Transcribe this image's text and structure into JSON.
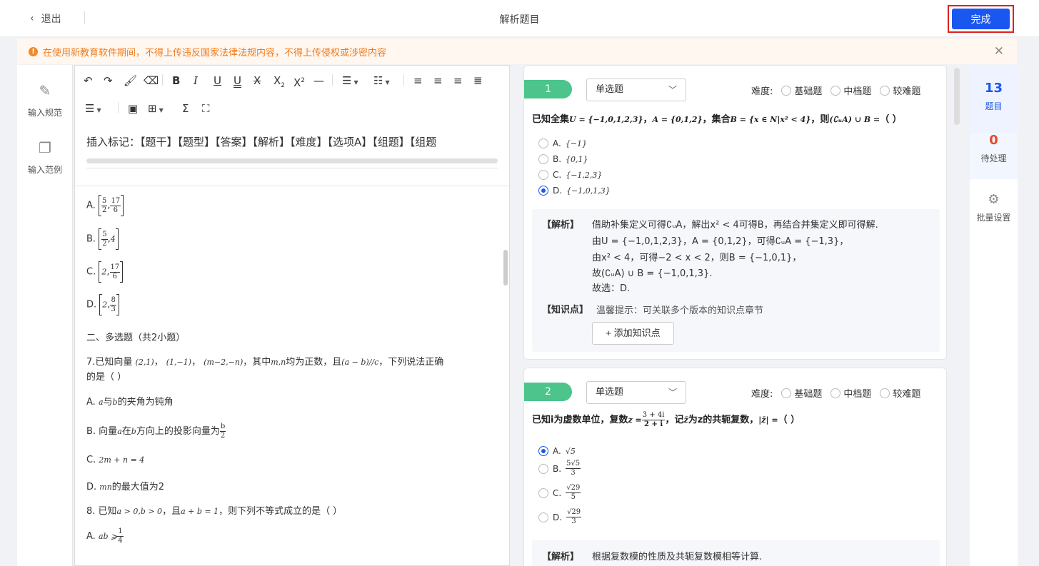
{
  "header": {
    "exit_label": "退出",
    "title": "解析题目",
    "done_label": "完成"
  },
  "notice": {
    "text": "在使用新教育软件期间，不得上传违反国家法律法规内容，不得上传侵权或涉密内容"
  },
  "leftnav": {
    "items": [
      {
        "label": "输入规范"
      },
      {
        "label": "输入范例"
      }
    ]
  },
  "editor": {
    "insert_marks": "插入标记：【题干】【题型】【答案】【解析】【难度】【选项A】【组题】【组题",
    "lines": [
      "A.",
      "B.",
      "C.",
      "D.",
      "二、多选题（共2小题）",
      "7.已知向量",
      "的是（  ）",
      "A. ",
      "B. 向量",
      "C. ",
      "D. ",
      "8. 已知",
      "A. "
    ],
    "frag": {
      "a_fracs": [
        "5",
        "2",
        "17",
        "6"
      ],
      "b": "4",
      "c": "2",
      "d_fracs": [
        "8",
        "3"
      ],
      "q7_a": "(2,1)",
      "q7_b": "(1,−1)",
      "q7_c": "(m−2,−n)",
      "q7_mid": "，其中",
      "q7_mn": "m,n",
      "q7_tail": "均为正数，且",
      "q7_cond": "(a − b)//c",
      "q7_end": "，下列说法正确",
      "q7a_txt": "与",
      "q7a_end": "的夹角为钝角",
      "q7b_mid": "在",
      "q7b_end": "方向上的投影向量为",
      "q7c": "2m + n = 4",
      "q7d_mn": "mn",
      "q7d_txt": "的最大值为2",
      "q8_cond1": "a > 0,b > 0",
      "q8_mid": "，且",
      "q8_cond2": "a + b = 1",
      "q8_end": "，则下列不等式成立的是（    ）",
      "q8a": "ab ⩾",
      "q8a_f": [
        "1",
        "4"
      ]
    }
  },
  "questions": [
    {
      "number": "1",
      "type": "单选题",
      "difficulty_label": "难度:",
      "difficulty_options": [
        "基础题",
        "中档题",
        "较难题"
      ],
      "stem_prefix": "已知全集",
      "stem_u": "U = {−1,0,1,2,3}",
      "stem_a": "A = {0,1,2}",
      "stem_mid": "，集合",
      "stem_b": "B = {x ∈ N|x² < 4}",
      "stem_then": "，则",
      "stem_expr": "(∁ᵤA) ∪ B =",
      "stem_end": "（  ）",
      "options": [
        {
          "label": "A.",
          "value": "{−1}",
          "selected": false
        },
        {
          "label": "B.",
          "value": "{0,1}",
          "selected": false
        },
        {
          "label": "C.",
          "value": "{−1,2,3}",
          "selected": false
        },
        {
          "label": "D.",
          "value": "{−1,0,1,3}",
          "selected": true
        }
      ],
      "analysis_label": "【解析】",
      "analysis": [
        "借助补集定义可得∁ᵤA，解出x² < 4可得B，再结合并集定义即可得解.",
        "由U = {−1,0,1,2,3}，A = {0,1,2}，可得∁ᵤA = {−1,3}，",
        "由x² < 4，可得−2 < x < 2，则B = {−1,0,1}，",
        "故(∁ᵤA) ∪ B = {−1,0,1,3}.",
        "故选：D."
      ],
      "kp_label": "【知识点】",
      "kp_hint": "温馨提示：可关联多个版本的知识点章节",
      "add_kp_label": "+ 添加知识点"
    },
    {
      "number": "2",
      "type": "单选题",
      "difficulty_label": "难度:",
      "difficulty_options": [
        "基础题",
        "中档题",
        "较难题"
      ],
      "stem_prefix": "已知i为虚数单位，复数",
      "stem_z": "z =",
      "stem_frac": [
        "3 + 4i",
        "2 + i"
      ],
      "stem_mid": "，记",
      "stem_zbar": "z̄",
      "stem_mid2": "为z的共轭复数，",
      "stem_abs": "|z̄| =",
      "stem_end": "（  ）",
      "options": [
        {
          "label": "A.",
          "value": "√5",
          "selected": true
        },
        {
          "label": "B.",
          "num": "5√5",
          "den": "3",
          "selected": false
        },
        {
          "label": "C.",
          "num": "√29",
          "den": "5",
          "selected": false
        },
        {
          "label": "D.",
          "num": "√29",
          "den": "3",
          "selected": false
        }
      ],
      "analysis_label": "【解析】",
      "analysis": [
        "根据复数模的性质及共轭复数模相等计算."
      ]
    }
  ],
  "rside": {
    "count_total": "13",
    "count_total_label": "题目",
    "count_pending": "0",
    "count_pending_label": "待处理",
    "batch_label": "批量设置"
  },
  "colors": {
    "accent": "#1a56f0",
    "qnum": "#4cc48c",
    "notice": "#f07a1a",
    "pending": "#e04a2a",
    "done_outline": "#e02020"
  }
}
